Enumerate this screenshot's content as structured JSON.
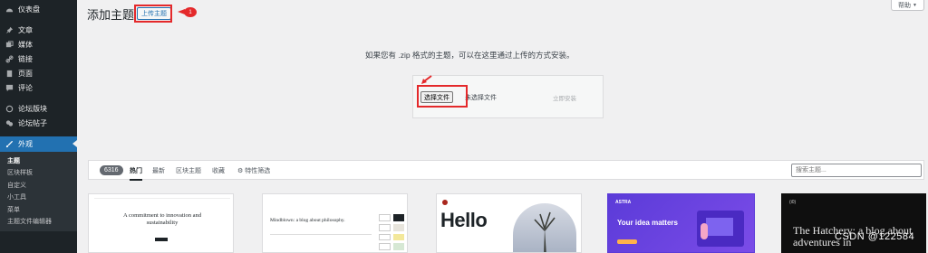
{
  "sidebar": {
    "items_top": [
      {
        "label": "仪表盘",
        "icon": "dashboard-icon"
      }
    ],
    "items_mid": [
      {
        "label": "文章",
        "icon": "pin-icon"
      },
      {
        "label": "媒体",
        "icon": "media-icon"
      },
      {
        "label": "链接",
        "icon": "link-icon"
      },
      {
        "label": "页面",
        "icon": "page-icon"
      },
      {
        "label": "评论",
        "icon": "comment-icon"
      }
    ],
    "items_forum": [
      {
        "label": "论坛版块",
        "icon": "forum-icon"
      },
      {
        "label": "论坛帖子",
        "icon": "topic-icon"
      }
    ],
    "active": {
      "label": "外观",
      "icon": "brush-icon"
    },
    "submenu": [
      "主题",
      "区块样板",
      "自定义",
      "小工具",
      "菜单",
      "主题文件编辑器"
    ]
  },
  "header": {
    "title": "添加主题",
    "upload_label": "上传主题",
    "annotation_number": "1",
    "help_label": "帮助"
  },
  "upload": {
    "description": "如果您有 .zip 格式的主题，可以在这里通过上传的方式安装。",
    "choose_file_label": "选择文件",
    "no_file_text": "未选择文件",
    "install_label": "立即安装"
  },
  "filter": {
    "count": "6316",
    "tabs": [
      "热门",
      "最新",
      "区块主题",
      "收藏"
    ],
    "feature_filter_label": "特性筛选",
    "search_placeholder": "搜索主题..."
  },
  "cards": {
    "card1_heading": "A commitment to innovation and sustainability",
    "card2_heading": "Mindblown: a blog about philosophy.",
    "card3_heading": "Hello",
    "card4_heading": "Your idea matters",
    "card4_brand": "ASTRA",
    "card5_heading": "The Hatchery: a blog about adventures in"
  },
  "watermark": "CSDN @122584",
  "colors": {
    "sidebar_bg": "#1d2327",
    "accent": "#2271b1",
    "highlight": "#e4292b",
    "astra_purple": "#5b3bd8"
  }
}
